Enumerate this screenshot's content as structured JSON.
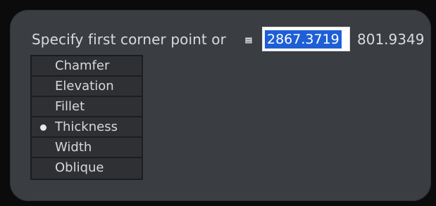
{
  "prompt": {
    "text": "Specify first corner point or",
    "grip_icon": "grip-icon"
  },
  "coordinates": {
    "x_input_value": "2867.3719",
    "y_value": "801.9349"
  },
  "options_menu": {
    "items": [
      {
        "label": "Chamfer",
        "selected": false
      },
      {
        "label": "Elevation",
        "selected": false
      },
      {
        "label": "Fillet",
        "selected": false
      },
      {
        "label": "Thickness",
        "selected": true
      },
      {
        "label": "Width",
        "selected": false
      },
      {
        "label": "Oblique",
        "selected": false
      }
    ]
  },
  "colors": {
    "panel_background": "#3a3d42",
    "menu_background": "#2e3034",
    "selection_highlight": "#1f5fd6",
    "text": "#d9dbde"
  }
}
